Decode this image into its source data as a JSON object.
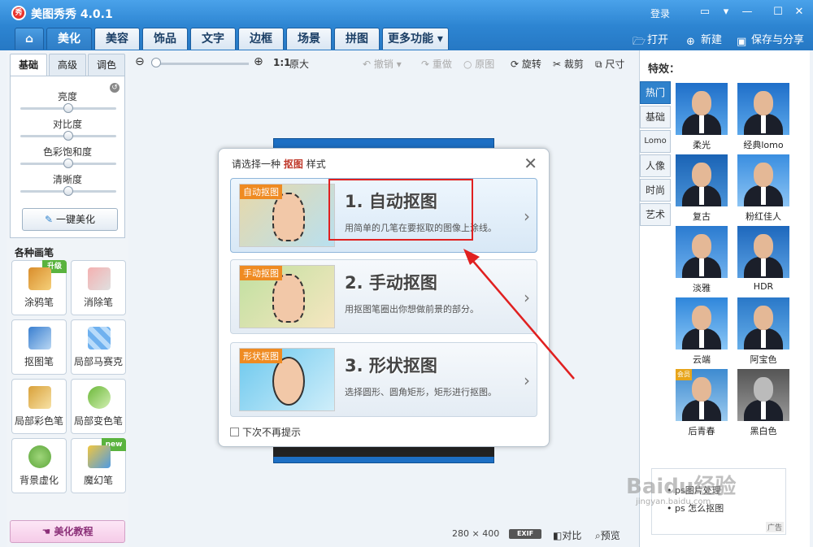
{
  "window": {
    "title": "美图秀秀 4.0.1",
    "login": "登录"
  },
  "tabs": [
    {
      "label": "美化"
    },
    {
      "label": "美容"
    },
    {
      "label": "饰品"
    },
    {
      "label": "文字"
    },
    {
      "label": "边框"
    },
    {
      "label": "场景"
    },
    {
      "label": "拼图"
    },
    {
      "label": "更多功能 ▾"
    }
  ],
  "top_actions": {
    "open": "打开",
    "new": "新建",
    "save_share": "保存与分享"
  },
  "left": {
    "subtabs": [
      "基础",
      "高级",
      "调色"
    ],
    "sliders": [
      {
        "label": "亮度",
        "value": 0.5
      },
      {
        "label": "对比度",
        "value": 0.5
      },
      {
        "label": "色彩饱和度",
        "value": 0.5
      },
      {
        "label": "清晰度",
        "value": 0.5
      }
    ],
    "onekey_label": "一键美化",
    "brushes_title": "各种画笔",
    "tools": [
      {
        "label": "涂鸦笔",
        "badge": "升级"
      },
      {
        "label": "消除笔",
        "badge": ""
      },
      {
        "label": "抠图笔",
        "badge": ""
      },
      {
        "label": "局部马赛克",
        "badge": ""
      },
      {
        "label": "局部彩色笔",
        "badge": ""
      },
      {
        "label": "局部变色笔",
        "badge": ""
      },
      {
        "label": "背景虚化",
        "badge": ""
      },
      {
        "label": "魔幻笔",
        "badge": "new"
      }
    ],
    "tutorial_label": "美化教程"
  },
  "toolbar": {
    "ratio": "1:1",
    "original_size": "原大",
    "undo": "撤销",
    "redo": "重做",
    "original": "原图",
    "rotate": "旋转",
    "crop": "裁剪",
    "size": "尺寸"
  },
  "status": {
    "width": "280",
    "times": "×",
    "height": "400",
    "exif": "EXIF",
    "compare": "对比",
    "preview": "预览"
  },
  "dialog": {
    "title_prefix": "请选择一种",
    "title_highlight": "抠图",
    "title_suffix": "样式",
    "options": [
      {
        "tag": "自动抠图",
        "title": "1. 自动抠图",
        "desc": "用简单的几笔在要抠取的图像上涂线。"
      },
      {
        "tag": "手动抠图",
        "title": "2. 手动抠图",
        "desc": "用抠图笔圈出你想做前景的部分。"
      },
      {
        "tag": "形状抠图",
        "title": "3. 形状抠图",
        "desc": "选择圆形、圆角矩形，矩形进行抠图。"
      }
    ],
    "checkbox_label": "下次不再提示"
  },
  "right": {
    "title": "特效：",
    "tabs": [
      "热门",
      "基础",
      "Lomo",
      "人像",
      "时尚",
      "艺术"
    ],
    "effects": [
      {
        "label": "柔光",
        "badge": ""
      },
      {
        "label": "经典lomo",
        "badge": ""
      },
      {
        "label": "复古",
        "badge": ""
      },
      {
        "label": "粉红佳人",
        "badge": ""
      },
      {
        "label": "淡雅",
        "badge": ""
      },
      {
        "label": "HDR",
        "badge": ""
      },
      {
        "label": "云端",
        "badge": ""
      },
      {
        "label": "阿宝色",
        "badge": ""
      },
      {
        "label": "后青春",
        "badge": "会员"
      },
      {
        "label": "黑白色",
        "badge": ""
      }
    ],
    "ad_items": [
      "ps图片处理",
      "ps 怎么抠图"
    ],
    "ad_tag": "广告"
  },
  "watermark": {
    "text": "Baidu经验",
    "url": "jingyan.baidu.com"
  },
  "colors": {
    "accent": "#2f82cc",
    "highlight_red": "#e02020"
  }
}
